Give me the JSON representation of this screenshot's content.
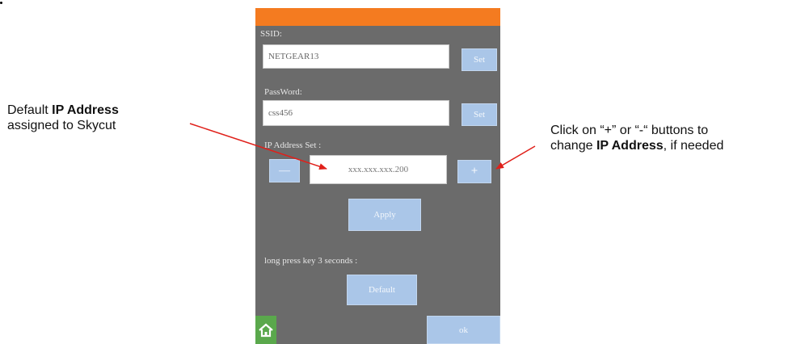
{
  "screen": {
    "ssid": {
      "label": "SSID:",
      "value": "NETGEAR13",
      "set_label": "Set"
    },
    "password": {
      "label": "PassWord:",
      "value": "css456",
      "set_label": "Set"
    },
    "ip": {
      "label": "IP Address Set :",
      "value": "xxx.xxx.xxx.200",
      "minus_label": "—",
      "plus_label": "+"
    },
    "apply_label": "Apply",
    "long_press_text": "long press key 3 seconds :",
    "default_label": "Default",
    "ok_label": "ok"
  },
  "annotations": {
    "left": {
      "line1_pre": "Default ",
      "line1_bold": "IP Address",
      "line2": "assigned to Skycut"
    },
    "right": {
      "line1": "Click on “+” or “-“ buttons to",
      "line2_pre": "change ",
      "line2_bold": "IP Address",
      "line2_post": ", if needed"
    }
  },
  "colors": {
    "top_bar": "#f47b20",
    "panel_bg": "#6b6b6b",
    "button": "#aac6e8",
    "home_button": "#5aa84c",
    "arrow": "#e0201a"
  },
  "icons": {
    "home": "home-icon"
  }
}
